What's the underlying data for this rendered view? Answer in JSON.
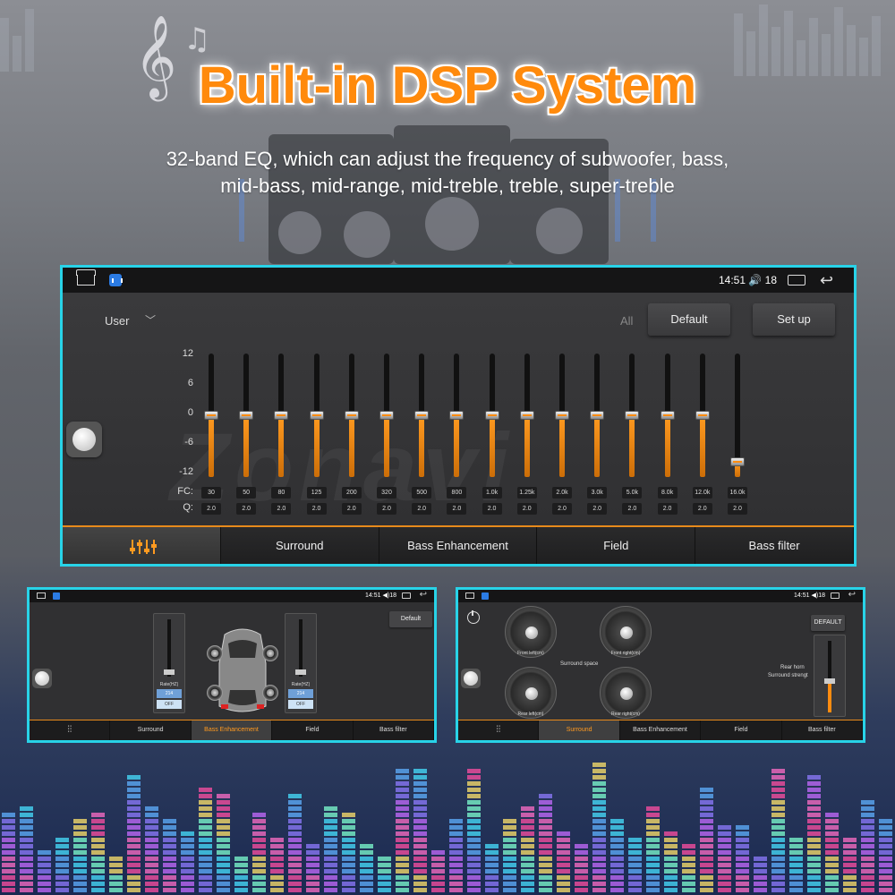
{
  "banner": {
    "title": "Built-in DSP System",
    "subtitle_line1": "32-band EQ, which can adjust the frequency of subwoofer, bass,",
    "subtitle_line2": "mid-bass, mid-range, mid-treble, treble, super-treble"
  },
  "main_screen": {
    "status": {
      "time": "14:51",
      "volume": "18"
    },
    "watermark": "Zonavi",
    "preset": "User",
    "all_label": "All",
    "default_label": "Default",
    "setup_label": "Set up",
    "y_ticks": [
      "12",
      "6",
      "0",
      "-6",
      "-12"
    ],
    "fc_label": "FC:",
    "q_label": "Q:",
    "bands": [
      {
        "fc": "30",
        "q": "2.0",
        "gain": 0
      },
      {
        "fc": "50",
        "q": "2.0",
        "gain": 0
      },
      {
        "fc": "80",
        "q": "2.0",
        "gain": 0
      },
      {
        "fc": "125",
        "q": "2.0",
        "gain": 0
      },
      {
        "fc": "200",
        "q": "2.0",
        "gain": 0
      },
      {
        "fc": "320",
        "q": "2.0",
        "gain": 0
      },
      {
        "fc": "500",
        "q": "2.0",
        "gain": 0
      },
      {
        "fc": "800",
        "q": "2.0",
        "gain": 0
      },
      {
        "fc": "1.0k",
        "q": "2.0",
        "gain": 0
      },
      {
        "fc": "1.25k",
        "q": "2.0",
        "gain": 0
      },
      {
        "fc": "2.0k",
        "q": "2.0",
        "gain": 0
      },
      {
        "fc": "3.0k",
        "q": "2.0",
        "gain": 0
      },
      {
        "fc": "5.0k",
        "q": "2.0",
        "gain": 0
      },
      {
        "fc": "8.0k",
        "q": "2.0",
        "gain": 0
      },
      {
        "fc": "12.0k",
        "q": "2.0",
        "gain": 0
      },
      {
        "fc": "16.0k",
        "q": "2.0",
        "gain": -9
      }
    ],
    "tabs": [
      "Surround",
      "Bass Enhancement",
      "Field",
      "Bass filter"
    ]
  },
  "left_screen": {
    "status": {
      "time": "14:51",
      "volume": "18"
    },
    "default_label": "Default",
    "left_panel": {
      "rate_label": "Rate(HZ)",
      "value": "214",
      "switch": "OFF"
    },
    "right_panel": {
      "rate_label": "Rate(HZ)",
      "value": "214",
      "switch": "OFF"
    },
    "tabs": [
      "Surround",
      "Bass Enhancement",
      "Field",
      "Bass filter"
    ],
    "active_tab": "Bass Enhancement"
  },
  "right_screen": {
    "status": {
      "time": "14:51",
      "volume": "18"
    },
    "default_label": "DEFAULT",
    "knobs": [
      "Front left(cm)",
      "Front right(cm)",
      "Rear left(cm)",
      "Rear right(cm)"
    ],
    "surround_space": "Surround space",
    "rear_horn": "Rear horn",
    "surround_strength": "Surround strengt",
    "tabs": [
      "Surround",
      "Bass Enhancement",
      "Field",
      "Bass filter"
    ],
    "active_tab": "Surround"
  },
  "colors": {
    "accent": "#ff8a0c",
    "frame": "#28d3e8"
  },
  "icons": [
    "home-icon",
    "app-icon",
    "volume-icon",
    "recent-apps-icon",
    "back-icon",
    "equalizer-icon",
    "power-icon"
  ]
}
